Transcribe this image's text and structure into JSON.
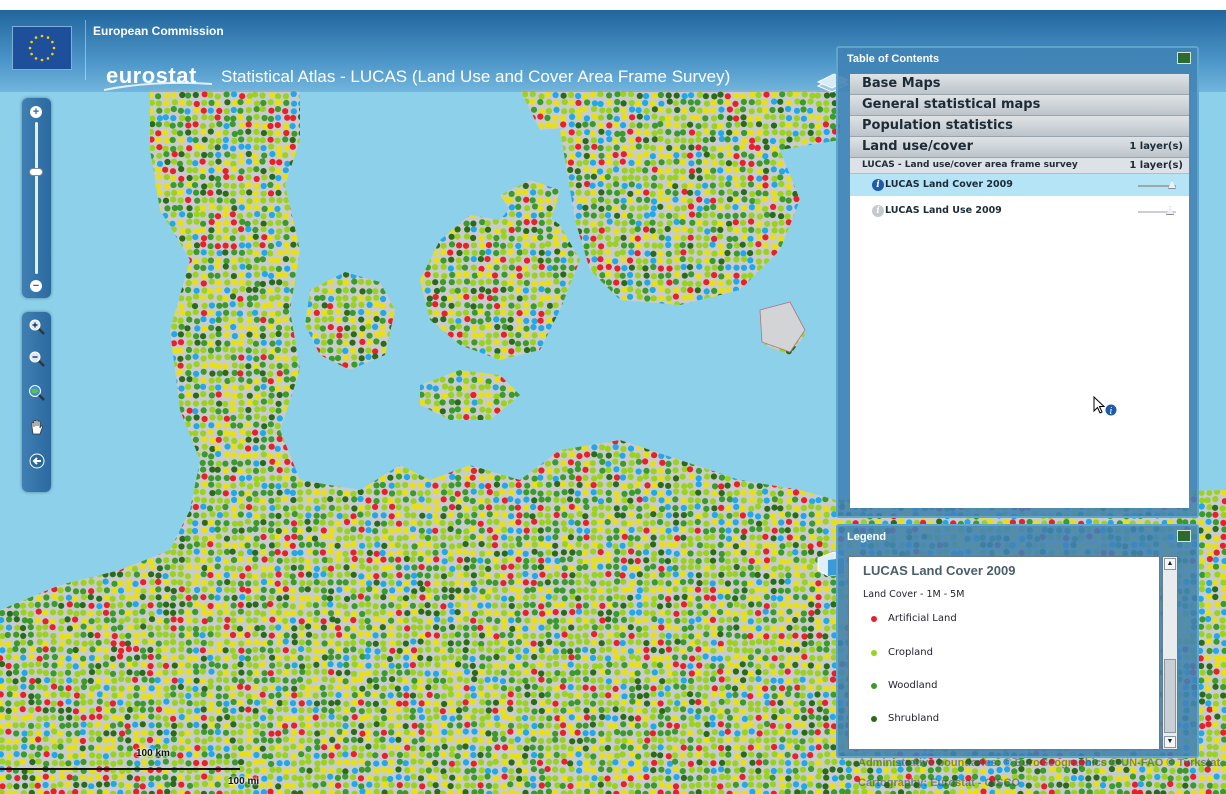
{
  "header": {
    "org": "European Commission",
    "logo": "eurostat",
    "title": "Statistical Atlas - LUCAS (Land Use and Cover Area Frame Survey)"
  },
  "toolbar": {
    "zoom_in_symbol": "+",
    "zoom_out_symbol": "−",
    "tools": [
      "zoom-in-icon",
      "zoom-out-icon",
      "globe-zoom-icon",
      "pan-hand-icon",
      "back-arrow-icon"
    ]
  },
  "toc": {
    "title": "Table of Contents",
    "groups": [
      {
        "label": "Base Maps"
      },
      {
        "label": "General statistical maps"
      },
      {
        "label": "Population statistics"
      },
      {
        "label": "Land use/cover",
        "count": "1 layer(s)"
      }
    ],
    "subgroup": {
      "label": "LUCAS - Land use/cover area frame survey",
      "count": "1 layer(s)"
    },
    "layers": [
      {
        "label": "LUCAS Land Cover 2009",
        "selected": true,
        "info_symbol": "i"
      },
      {
        "label": "LUCAS Land Use 2009",
        "selected": false,
        "info_symbol": "i"
      }
    ]
  },
  "legend": {
    "title": "Legend",
    "layer_title": "LUCAS Land Cover 2009",
    "subtitle": "Land Cover - 1M - 5M",
    "items": [
      {
        "label": "Artificial Land",
        "color": "#e8202a"
      },
      {
        "label": "Cropland",
        "color": "#9ad21e"
      },
      {
        "label": "Woodland",
        "color": "#3a9a2a"
      },
      {
        "label": "Shrubland",
        "color": "#2a6a18"
      }
    ],
    "scroll_up": "▲",
    "scroll_down": "▼"
  },
  "scale": {
    "km": "100 km",
    "mi": "100 mi"
  },
  "attribution": {
    "line1": "Administrative boundaries: © EuroGeographics © UN-FAO © Turkstat",
    "line2": "Cartography: Eurostat - GISCO"
  },
  "colors": {
    "sea": "#8cd0ea",
    "land": "#c8ccd0",
    "dot_palette": [
      "#9ad21e",
      "#9ad21e",
      "#9ad21e",
      "#3a9a2a",
      "#3a9a2a",
      "#e8e010",
      "#e8e010",
      "#2a6a18",
      "#e8202a",
      "#20a8e8"
    ]
  }
}
